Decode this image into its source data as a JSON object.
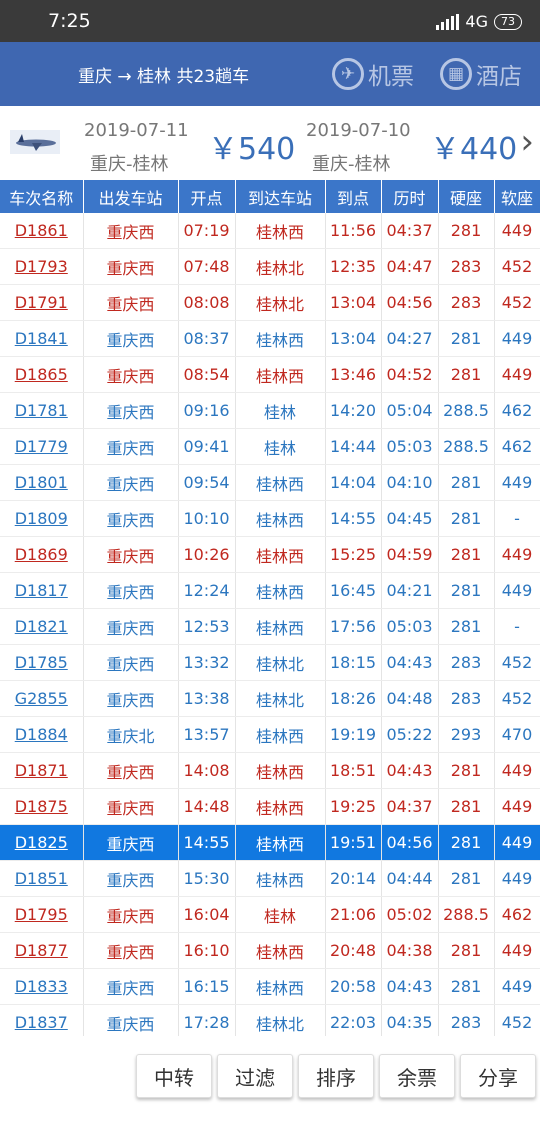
{
  "status": {
    "time": "7:25",
    "network": "4G",
    "battery": "73"
  },
  "header": {
    "title": "重庆 → 桂林 共23趟车",
    "flight_label": "机票",
    "hotel_label": "酒店",
    "flight_icon": "plane-icon",
    "hotel_icon": "building-icon"
  },
  "flights": [
    {
      "date": "2019-07-11",
      "route": "重庆-桂林",
      "price": "￥540"
    },
    {
      "date": "2019-07-10",
      "route": "重庆-桂林",
      "price": "￥440"
    }
  ],
  "columns": [
    "车次名称",
    "出发车站",
    "开点",
    "到达车站",
    "到点",
    "历时",
    "硬座",
    "软座"
  ],
  "colors": {
    "red": "#c0281f",
    "blue": "#2b76bf",
    "header": "#3b76c9",
    "selected": "#1178e0"
  },
  "trains": [
    {
      "cells": [
        "D1861",
        "重庆西",
        "07:19",
        "桂林西",
        "11:56",
        "04:37",
        "281",
        "449"
      ],
      "color": "red"
    },
    {
      "cells": [
        "D1793",
        "重庆西",
        "07:48",
        "桂林北",
        "12:35",
        "04:47",
        "283",
        "452"
      ],
      "color": "red"
    },
    {
      "cells": [
        "D1791",
        "重庆西",
        "08:08",
        "桂林北",
        "13:04",
        "04:56",
        "283",
        "452"
      ],
      "color": "red"
    },
    {
      "cells": [
        "D1841",
        "重庆西",
        "08:37",
        "桂林西",
        "13:04",
        "04:27",
        "281",
        "449"
      ],
      "color": "blue"
    },
    {
      "cells": [
        "D1865",
        "重庆西",
        "08:54",
        "桂林西",
        "13:46",
        "04:52",
        "281",
        "449"
      ],
      "color": "red"
    },
    {
      "cells": [
        "D1781",
        "重庆西",
        "09:16",
        "桂林",
        "14:20",
        "05:04",
        "288.5",
        "462"
      ],
      "color": "blue"
    },
    {
      "cells": [
        "D1779",
        "重庆西",
        "09:41",
        "桂林",
        "14:44",
        "05:03",
        "288.5",
        "462"
      ],
      "color": "blue"
    },
    {
      "cells": [
        "D1801",
        "重庆西",
        "09:54",
        "桂林西",
        "14:04",
        "04:10",
        "281",
        "449"
      ],
      "color": "blue"
    },
    {
      "cells": [
        "D1809",
        "重庆西",
        "10:10",
        "桂林西",
        "14:55",
        "04:45",
        "281",
        "-"
      ],
      "color": "blue"
    },
    {
      "cells": [
        "D1869",
        "重庆西",
        "10:26",
        "桂林西",
        "15:25",
        "04:59",
        "281",
        "449"
      ],
      "color": "red"
    },
    {
      "cells": [
        "D1817",
        "重庆西",
        "12:24",
        "桂林西",
        "16:45",
        "04:21",
        "281",
        "449"
      ],
      "color": "blue"
    },
    {
      "cells": [
        "D1821",
        "重庆西",
        "12:53",
        "桂林西",
        "17:56",
        "05:03",
        "281",
        "-"
      ],
      "color": "blue"
    },
    {
      "cells": [
        "D1785",
        "重庆西",
        "13:32",
        "桂林北",
        "18:15",
        "04:43",
        "283",
        "452"
      ],
      "color": "blue"
    },
    {
      "cells": [
        "G2855",
        "重庆西",
        "13:38",
        "桂林北",
        "18:26",
        "04:48",
        "283",
        "452"
      ],
      "color": "blue"
    },
    {
      "cells": [
        "D1884",
        "重庆北",
        "13:57",
        "桂林西",
        "19:19",
        "05:22",
        "293",
        "470"
      ],
      "color": "blue"
    },
    {
      "cells": [
        "D1871",
        "重庆西",
        "14:08",
        "桂林西",
        "18:51",
        "04:43",
        "281",
        "449"
      ],
      "color": "red"
    },
    {
      "cells": [
        "D1875",
        "重庆西",
        "14:48",
        "桂林西",
        "19:25",
        "04:37",
        "281",
        "449"
      ],
      "color": "red"
    },
    {
      "cells": [
        "D1825",
        "重庆西",
        "14:55",
        "桂林西",
        "19:51",
        "04:56",
        "281",
        "449"
      ],
      "color": "selected"
    },
    {
      "cells": [
        "D1851",
        "重庆西",
        "15:30",
        "桂林西",
        "20:14",
        "04:44",
        "281",
        "449"
      ],
      "color": "blue"
    },
    {
      "cells": [
        "D1795",
        "重庆西",
        "16:04",
        "桂林",
        "21:06",
        "05:02",
        "288.5",
        "462"
      ],
      "color": "red"
    },
    {
      "cells": [
        "D1877",
        "重庆西",
        "16:10",
        "桂林西",
        "20:48",
        "04:38",
        "281",
        "449"
      ],
      "color": "red"
    },
    {
      "cells": [
        "D1833",
        "重庆西",
        "16:15",
        "桂林西",
        "20:58",
        "04:43",
        "281",
        "449"
      ],
      "color": "blue"
    },
    {
      "cells": [
        "D1837",
        "重庆西",
        "17:28",
        "桂林北",
        "22:03",
        "04:35",
        "283",
        "452"
      ],
      "color": "blue"
    }
  ],
  "bottom_buttons": [
    "中转",
    "过滤",
    "排序",
    "余票",
    "分享"
  ]
}
